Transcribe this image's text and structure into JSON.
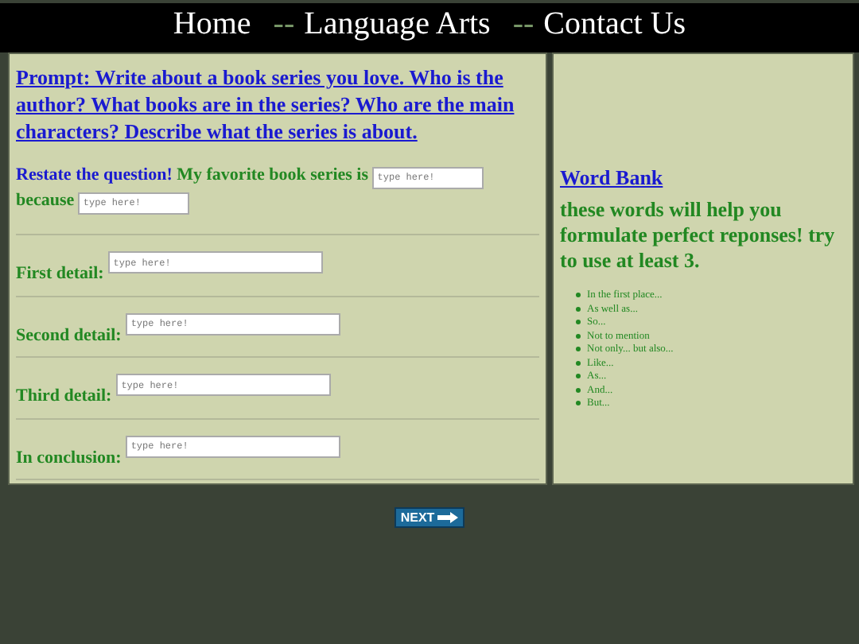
{
  "nav": [
    {
      "label": "Home"
    },
    {
      "separator": "--",
      "label": "Language Arts"
    },
    {
      "separator": "--",
      "label": "Contact Us"
    }
  ],
  "prompt": "Prompt: Write about a book series you love. Who is the author? What books are in the series? Who are the main characters? Describe what the series is about.",
  "restate": {
    "label": "Restate the question!",
    "before": "My favorite book series is",
    "field1": {
      "placeholder": "type here!"
    },
    "after": "because",
    "field2": {
      "placeholder": "type here!"
    }
  },
  "details": [
    {
      "label": "First detail:",
      "placeholder": "type here!"
    },
    {
      "label": "Second detail:",
      "placeholder": "type here!"
    },
    {
      "label": "Third detail:",
      "placeholder": "type here!"
    },
    {
      "label": "In conclusion:",
      "placeholder": "type here!"
    }
  ],
  "word_bank": {
    "title": "Word Bank",
    "intro": "these words will help you formulate perfect reponses! try to use at least 3.",
    "words": [
      "In the first place...",
      "As well as...",
      "So...",
      "Not to mention",
      "Not only... but also...",
      "Like...",
      "As...",
      "And...",
      "But..."
    ]
  },
  "next_button": {
    "label": "NEXT"
  }
}
